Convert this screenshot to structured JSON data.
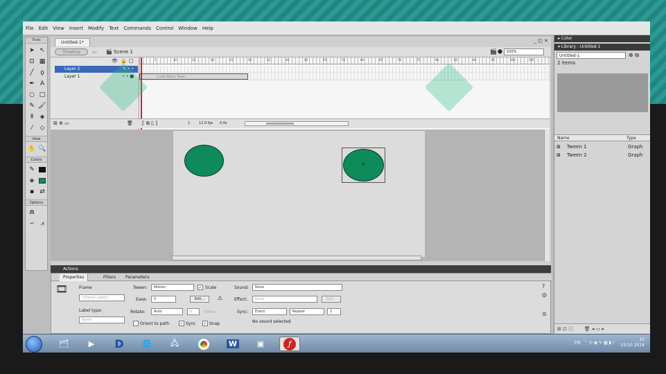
{
  "menu": [
    "File",
    "Edit",
    "View",
    "Insert",
    "Modify",
    "Text",
    "Commands",
    "Control",
    "Window",
    "Help"
  ],
  "toolbox": {
    "tools_title": "Tools",
    "view_title": "View",
    "colors_title": "Colors",
    "options_title": "Options"
  },
  "document": {
    "tab": "Untitled-1*",
    "timeline_button": "Timeline",
    "scene": "Scene 1",
    "zoom": "100%"
  },
  "timeline": {
    "ruler": [
      "5",
      "10",
      "15",
      "20",
      "25",
      "30",
      "35",
      "40",
      "45",
      "50",
      "55",
      "60",
      "65",
      "70",
      "75",
      "80",
      "85",
      "90",
      "95",
      "100",
      "105"
    ],
    "layers": [
      {
        "name": "Layer 2",
        "selected": true
      },
      {
        "name": "Layer 1",
        "selected": false
      }
    ],
    "tween_label": "Create Motion Tween",
    "frame": "1",
    "fps": "12.0 fps",
    "elapsed": "0.0s"
  },
  "panels": {
    "color": "Color",
    "library": "Library - Untitled-1",
    "library_select": "Untitled-1",
    "items_count": "2 items",
    "col_name": "Name",
    "col_type": "Type",
    "items": [
      {
        "name": "Tween 1",
        "type": "Graph"
      },
      {
        "name": "Tween 2",
        "type": "Graph"
      }
    ]
  },
  "actions": "Actions",
  "properties": {
    "tab_properties": "Properties",
    "tab_filters": "Filters",
    "tab_parameters": "Parameters",
    "frame_label": "Frame",
    "frame_placeholder": "<Frame Label>",
    "label_type": "Label type:",
    "label_type_value": "Name",
    "tween": "Tween:",
    "tween_value": "Motion",
    "scale": "Scale",
    "ease": "Ease:",
    "ease_value": "0",
    "edit": "Edit...",
    "rotate": "Rotate:",
    "rotate_value": "Auto",
    "rotate_times": "0",
    "times": "times",
    "orient": "Orient to path",
    "sync_chk": "Sync",
    "snap": "Snap",
    "sound": "Sound:",
    "sound_value": "None",
    "effect": "Effect:",
    "effect_value": "None",
    "effect_edit": "Edit...",
    "sync": "Sync:",
    "sync_value": "Event",
    "repeat_value": "Repeat",
    "repeat_count": "1",
    "no_sound": "No sound selected"
  },
  "tray": {
    "lang": "EN",
    "time": "10",
    "date": "25/10 2014"
  },
  "colors": {
    "shape": "#0f8a5a",
    "selected_layer": "#3a6ab8"
  }
}
